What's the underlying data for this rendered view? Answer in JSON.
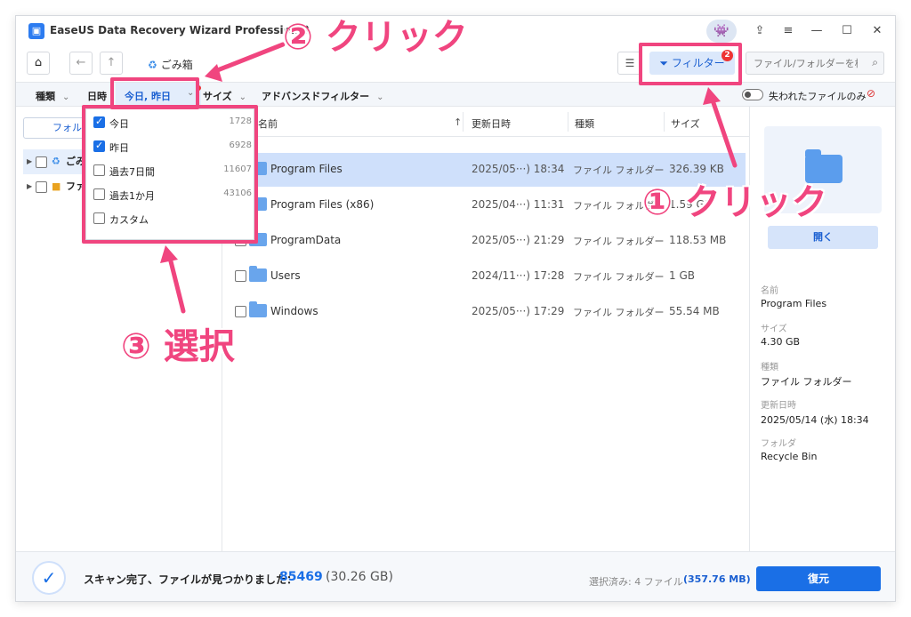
{
  "app": {
    "title": "EaseUS Data Recovery Wizard Professional",
    "logo_glyph": "▣",
    "controls": {
      "upload": "⇪",
      "menu": "≡",
      "minimize": "—",
      "maximize": "☐",
      "close": "✕"
    }
  },
  "nav": {
    "home_glyph": "⌂",
    "back_glyph": "←",
    "up_glyph": "↑",
    "breadcrumb": "ごみ箱",
    "list_view_glyph": "☰",
    "filter_label": "フィルター",
    "filter_badge": "2",
    "search_placeholder": "ファイル/フォルダーを検索"
  },
  "filters": {
    "type": "種類",
    "date_label": "日時",
    "date_value": "今日, 昨日",
    "size": "サイズ",
    "advanced": "アドバンスドフィルター",
    "lost_only": "失われたファイルのみ"
  },
  "left": {
    "tab": "フォルダ",
    "tree": [
      {
        "label": "ごみ箱"
      },
      {
        "label": "ファイル"
      }
    ]
  },
  "dropdown": {
    "items": [
      {
        "label": "今日",
        "count": "1728",
        "checked": true
      },
      {
        "label": "昨日",
        "count": "6928",
        "checked": true
      },
      {
        "label": "過去7日間",
        "count": "11607",
        "checked": false
      },
      {
        "label": "過去1か月",
        "count": "43106",
        "checked": false
      },
      {
        "label": "カスタム",
        "count": "",
        "checked": false
      }
    ]
  },
  "columns": {
    "name": "名前",
    "date": "更新日時",
    "type": "種類",
    "size": "サイズ"
  },
  "files": [
    {
      "name": "Program Files",
      "date": "2025/05···) 18:34",
      "type": "ファイル フォルダー",
      "size": "326.39 KB"
    },
    {
      "name": "Program Files (x86)",
      "date": "2025/04···) 11:31",
      "type": "ファイル フォルダー",
      "size": "1.59 GB"
    },
    {
      "name": "ProgramData",
      "date": "2025/05···) 21:29",
      "type": "ファイル フォルダー",
      "size": "118.53 MB"
    },
    {
      "name": "Users",
      "date": "2024/11···) 17:28",
      "type": "ファイル フォルダー",
      "size": "1 GB"
    },
    {
      "name": "Windows",
      "date": "2025/05···) 17:29",
      "type": "ファイル フォルダー",
      "size": "55.54 MB"
    }
  ],
  "details": {
    "open_label": "開く",
    "name_label": "名前",
    "name_value": "Program Files",
    "size_label": "サイズ",
    "size_value": "4.30 GB",
    "type_label": "種類",
    "type_value": "ファイル フォルダー",
    "date_label": "更新日時",
    "date_value": "2025/05/14 (水) 18:34",
    "folder_label": "フォルダ",
    "folder_value": "Recycle Bin"
  },
  "status": {
    "scan_text": "スキャン完了、ファイルが見つかりました：",
    "scan_count": "85469",
    "scan_size": "(30.26 GB)",
    "selected_text": "選択済み: 4 ファイル",
    "selected_size": "(357.76 MB)",
    "restore_label": "復元",
    "check_glyph": "✓"
  },
  "annotations": {
    "step1": "① クリック",
    "step2": "② クリック",
    "step3": "③ 選択",
    "color": "#f0457f"
  }
}
